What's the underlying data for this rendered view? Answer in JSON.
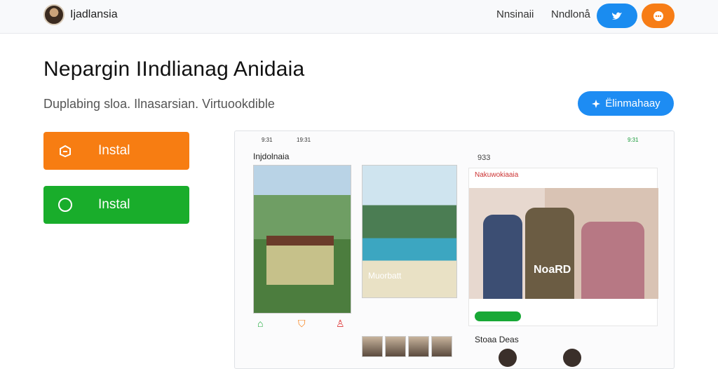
{
  "header": {
    "brand": "Ijadlansia",
    "nav": [
      "Nnsinaii",
      "Nndlonå"
    ],
    "pill_icons": [
      "twitter-icon",
      "chat-icon"
    ]
  },
  "hero": {
    "title": "Nepargin IIndlianag Anidaia",
    "subtitle": "Duplabing sloa. Ilnasarsian. Virtuookdible",
    "cta": "Ëlinmahaay"
  },
  "buttons": {
    "install_orange": "Instal",
    "install_green": "Instal"
  },
  "mockup": {
    "status_time_1": "9:31",
    "status_time_2": "19:31",
    "status_time_3": "9:31",
    "page_title": "Injdolnaia",
    "card2_caption": "Muorbatt",
    "right_time": "933",
    "right_header": "Nakuwokiaaia",
    "photo_caption": "NoaRD",
    "bottom_label": "Stoaa Deas"
  },
  "colors": {
    "orange": "#f77d12",
    "green": "#19ad2b",
    "blue": "#1d8cf3"
  }
}
